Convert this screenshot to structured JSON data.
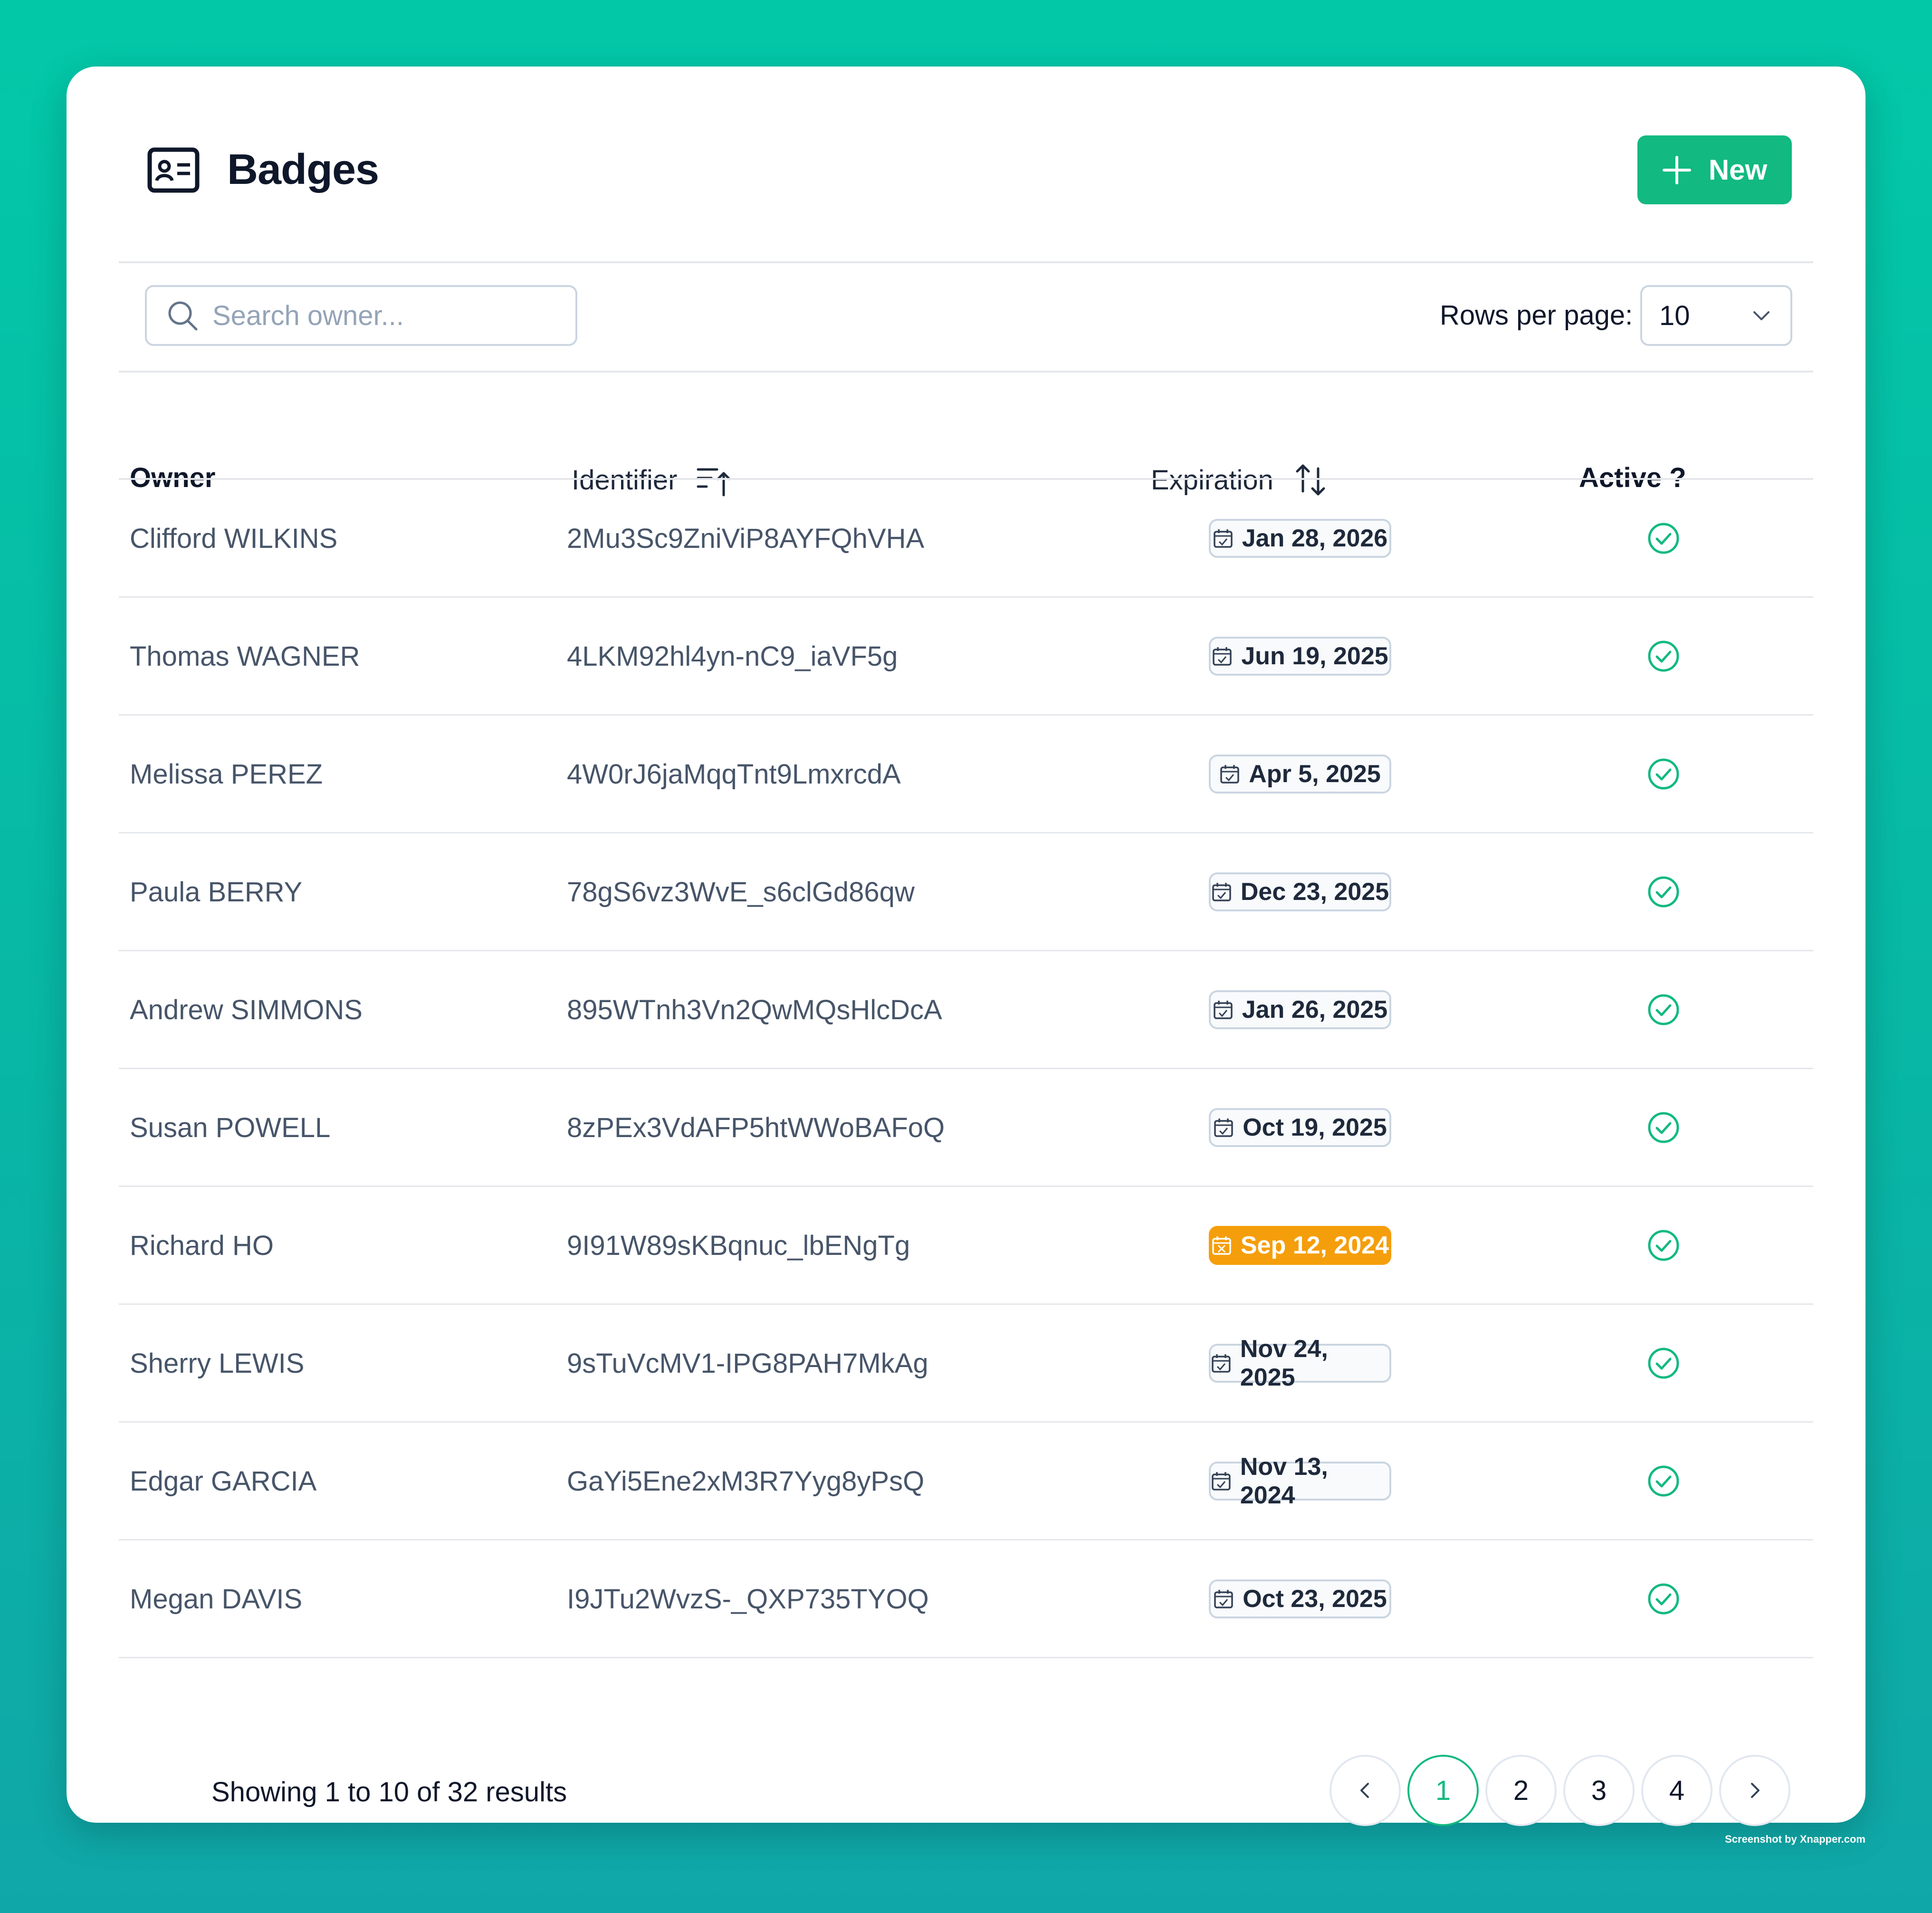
{
  "header": {
    "title": "Badges",
    "new_label": "New"
  },
  "search": {
    "placeholder": "Search owner..."
  },
  "pagination_controls": {
    "rows_label": "Rows per page:",
    "rows_value": "10"
  },
  "table": {
    "columns": {
      "owner": "Owner",
      "identifier": "Identifier",
      "expiration": "Expiration",
      "active": "Active ?"
    },
    "rows": [
      {
        "owner": "Clifford WILKINS",
        "identifier": "2Mu3Sc9ZniViP8AYFQhVHA",
        "expiration": "Jan 28, 2026",
        "expired": false
      },
      {
        "owner": "Thomas WAGNER",
        "identifier": "4LKM92hl4yn-nC9_iaVF5g",
        "expiration": "Jun 19, 2025",
        "expired": false
      },
      {
        "owner": "Melissa PEREZ",
        "identifier": "4W0rJ6jaMqqTnt9LmxrcdA",
        "expiration": "Apr 5, 2025",
        "expired": false
      },
      {
        "owner": "Paula BERRY",
        "identifier": "78gS6vz3WvE_s6clGd86qw",
        "expiration": "Dec 23, 2025",
        "expired": false
      },
      {
        "owner": "Andrew SIMMONS",
        "identifier": "895WTnh3Vn2QwMQsHlcDcA",
        "expiration": "Jan 26, 2025",
        "expired": false
      },
      {
        "owner": "Susan POWELL",
        "identifier": "8zPEx3VdAFP5htWWoBAFoQ",
        "expiration": "Oct 19, 2025",
        "expired": false
      },
      {
        "owner": "Richard HO",
        "identifier": "9I91W89sKBqnuc_lbENgTg",
        "expiration": "Sep 12, 2024",
        "expired": true
      },
      {
        "owner": "Sherry LEWIS",
        "identifier": "9sTuVcMV1-IPG8PAH7MkAg",
        "expiration": "Nov 24, 2025",
        "expired": false
      },
      {
        "owner": "Edgar GARCIA",
        "identifier": "GaYi5Ene2xM3R7Yyg8yPsQ",
        "expiration": "Nov 13, 2024",
        "expired": false
      },
      {
        "owner": "Megan DAVIS",
        "identifier": "I9JTu2WvzS-_QXP735TYOQ",
        "expiration": "Oct 23, 2025",
        "expired": false
      }
    ]
  },
  "footer": {
    "showing": "Showing",
    "from": "1",
    "to_word": "to",
    "to": "10",
    "of_word": "of",
    "total": "32",
    "results_word": "results"
  },
  "pager": {
    "pages": [
      "1",
      "2",
      "3",
      "4"
    ],
    "current": "1"
  },
  "watermark": "Screenshot by Xnapper.com",
  "colors": {
    "accent": "#12b981",
    "warning": "#f59e0b",
    "background_top": "#03c8a8",
    "background_bottom": "#10a7a8"
  }
}
